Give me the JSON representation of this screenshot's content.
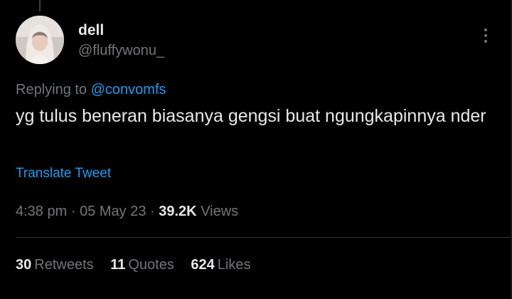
{
  "author": {
    "display_name": "dell",
    "handle": "@fluffywonu_"
  },
  "reply": {
    "prefix": "Replying to",
    "mention": "@convomfs"
  },
  "tweet": {
    "text": "yg tulus beneran biasanya gengsi buat ngungkapinnya nder",
    "translate_label": "Translate Tweet"
  },
  "meta": {
    "time": "4:38 pm",
    "separator": "·",
    "date": "05 May 23",
    "views_count": "39.2K",
    "views_label": "Views"
  },
  "stats": {
    "retweets_count": "30",
    "retweets_label": "Retweets",
    "quotes_count": "11",
    "quotes_label": "Quotes",
    "likes_count": "624",
    "likes_label": "Likes"
  },
  "colors": {
    "background": "#000000",
    "text_primary": "#e7e9ea",
    "text_secondary": "#71767b",
    "accent": "#1d9bf0",
    "divider": "#2f3336"
  },
  "icons": {
    "more": "more-vertical-icon"
  }
}
